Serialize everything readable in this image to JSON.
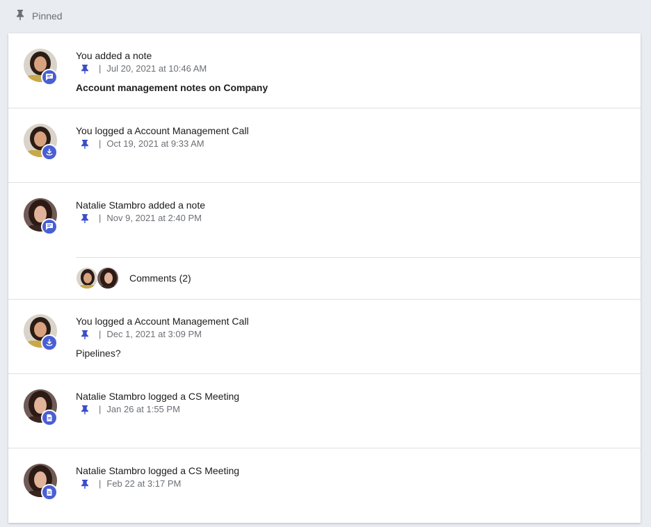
{
  "header": {
    "label": "Pinned",
    "icon": "pin-icon"
  },
  "colors": {
    "accent": "#4a5fd4",
    "pin": "#3b4ec9",
    "muted": "#6b6f75",
    "background": "#e9edf1"
  },
  "separator": "|",
  "items": [
    {
      "title": "You added a note",
      "date": "Jul 20, 2021 at 10:46 AM",
      "body": "Account management notes on Company",
      "type_icon": "note-icon",
      "author": "you"
    },
    {
      "title": "You logged a Account Management Call",
      "date": "Oct 19, 2021 at 9:33 AM",
      "body": "",
      "type_icon": "call-icon",
      "author": "you"
    },
    {
      "title": "Natalie Stambro added a note",
      "date": "Nov 9, 2021 at 2:40 PM",
      "body": "",
      "type_icon": "note-icon",
      "author": "natalie",
      "comments_label": "Comments (2)"
    },
    {
      "title": "You logged a Account Management Call",
      "date": "Dec 1, 2021 at 3:09 PM",
      "body": "Pipelines?",
      "type_icon": "call-icon",
      "author": "you"
    },
    {
      "title": "Natalie Stambro logged a CS Meeting",
      "date": "Jan 26 at 1:55 PM",
      "body": "",
      "type_icon": "meeting-icon",
      "author": "natalie"
    },
    {
      "title": "Natalie Stambro logged a CS Meeting",
      "date": "Feb 22 at 3:17 PM",
      "body": "",
      "type_icon": "meeting-icon",
      "author": "natalie"
    }
  ]
}
